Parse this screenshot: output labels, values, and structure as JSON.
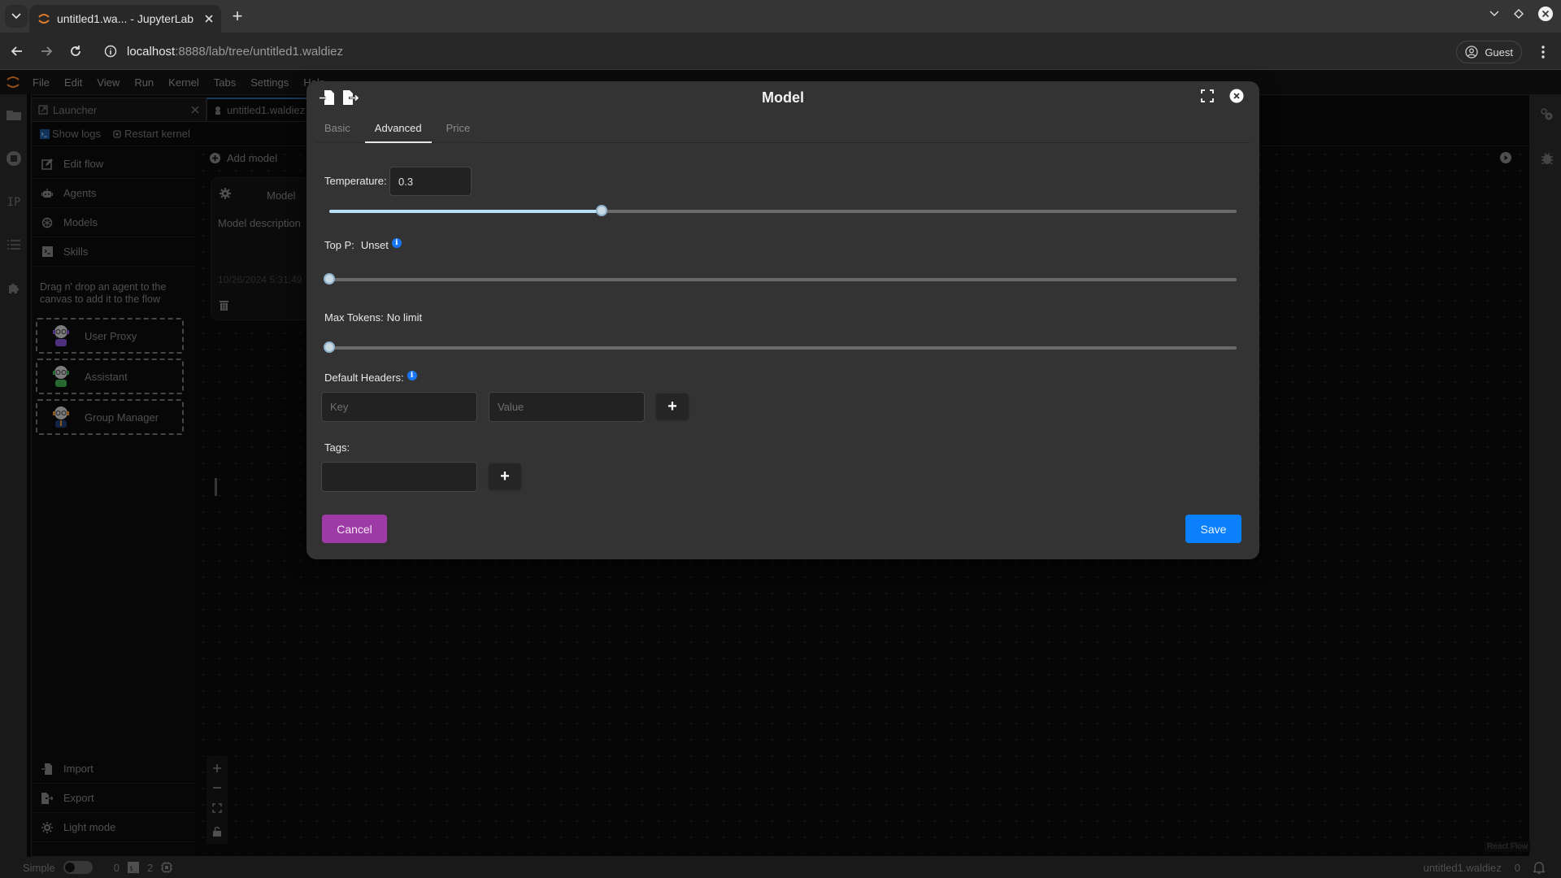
{
  "browser": {
    "tab_title": "untitled1.wa... - JupyterLab",
    "url_host": "localhost",
    "url_path": ":8888/lab/tree/untitled1.waldiez",
    "profile_label": "Guest"
  },
  "jupyter": {
    "menu": [
      "File",
      "Edit",
      "View",
      "Run",
      "Kernel",
      "Tabs",
      "Settings",
      "Help"
    ],
    "tabs": [
      {
        "label": "Launcher"
      },
      {
        "label": "untitled1.waldiez"
      }
    ],
    "toolbar": {
      "show_logs": "Show logs",
      "restart_kernel": "Restart kernel"
    },
    "left_rail_ip_label": "IP"
  },
  "sidebar": {
    "items": [
      {
        "label": "Edit flow",
        "icon": "edit-icon"
      },
      {
        "label": "Agents",
        "icon": "robot-icon"
      },
      {
        "label": "Models",
        "icon": "openai-icon"
      },
      {
        "label": "Skills",
        "icon": "terminal-icon"
      }
    ],
    "hint": "Drag n' drop an agent to the canvas to add it to the flow",
    "agents": [
      {
        "label": "User Proxy",
        "accent": "#7a4bc4"
      },
      {
        "label": "Assistant",
        "accent": "#3aa04a"
      },
      {
        "label": "Group Manager",
        "accent": "#d08a2a"
      }
    ],
    "bottom_items": [
      {
        "label": "Import"
      },
      {
        "label": "Export"
      },
      {
        "label": "Light mode"
      }
    ]
  },
  "canvas": {
    "add_model_label": "Add model",
    "model_card": {
      "name": "Model",
      "description": "Model description",
      "date": "10/26/2024 5:31:49"
    },
    "attribution": "React Flow"
  },
  "status_bar": {
    "mode_label": "Simple",
    "terminals_count": "0",
    "kernels_count": "2",
    "filename": "untitled1.waldiez",
    "notifications_count": "0"
  },
  "modal": {
    "title": "Model",
    "tabs": [
      {
        "label": "Basic",
        "active": false
      },
      {
        "label": "Advanced",
        "active": true
      },
      {
        "label": "Price",
        "active": false
      }
    ],
    "temperature": {
      "label": "Temperature:",
      "value": "0.3",
      "slider_fraction": 0.3
    },
    "top_p": {
      "label": "Top P:",
      "value_text": "Unset",
      "slider_fraction": 0.0
    },
    "max_tokens": {
      "label": "Max Tokens:",
      "value_text": "No limit",
      "slider_fraction": 0.0
    },
    "default_headers": {
      "label": "Default Headers:",
      "key_placeholder": "Key",
      "value_placeholder": "Value",
      "add_label": "+"
    },
    "tags": {
      "label": "Tags:",
      "value": "",
      "add_label": "+"
    },
    "cancel_label": "Cancel",
    "save_label": "Save",
    "colors": {
      "cancel": "#9d3aa6",
      "save": "#0a80ff",
      "info": "#1877f2",
      "slider_fill": "#b7e0f5"
    }
  }
}
